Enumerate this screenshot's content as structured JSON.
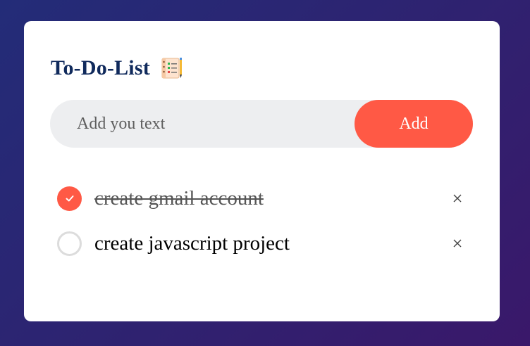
{
  "app": {
    "title": "To-Do-List",
    "title_icon": "notepad-checklist-icon"
  },
  "input": {
    "placeholder": "Add you text",
    "value": ""
  },
  "add_button": {
    "label": "Add"
  },
  "tasks": [
    {
      "text": "create gmail account",
      "done": true
    },
    {
      "text": "create javascript project",
      "done": false
    }
  ],
  "colors": {
    "accent": "#ff5945",
    "title": "#102a5c",
    "background_start": "#232c78",
    "background_end": "#3a186a",
    "input_bg": "#edeef0"
  },
  "icons": {
    "checked": "check-icon",
    "remove": "close-icon"
  }
}
